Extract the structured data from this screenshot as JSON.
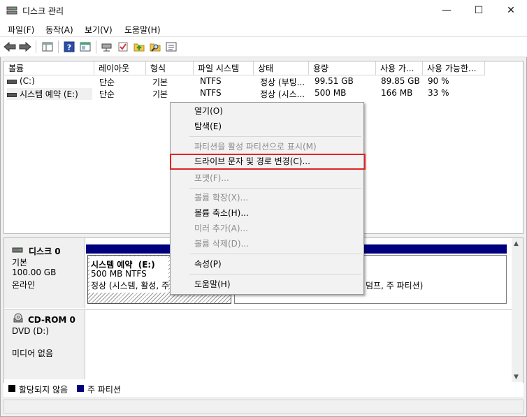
{
  "window": {
    "title": "디스크 관리",
    "minimize": "—",
    "maximize": "☐",
    "close": "✕"
  },
  "menu": [
    "파일(F)",
    "동작(A)",
    "보기(V)",
    "도움말(H)"
  ],
  "toolbar_icons": [
    "back-icon",
    "forward-icon",
    "console-tree-icon",
    "help-icon",
    "properties-icon",
    "connect-icon",
    "check-icon",
    "folder-up-icon",
    "search-icon",
    "settings-icon"
  ],
  "columns": [
    "볼륨",
    "레이아웃",
    "형식",
    "파일 시스템",
    "상태",
    "용량",
    "사용 가...",
    "사용 가능한..."
  ],
  "volumes": [
    {
      "name": "(C:)",
      "layout": "단순",
      "type": "기본",
      "fs": "NTFS",
      "status": "정상 (부팅...",
      "capacity": "99.51 GB",
      "free": "89.85 GB",
      "pct": "90 %"
    },
    {
      "name": "시스템 예약 (E:)",
      "layout": "단순",
      "type": "기본",
      "fs": "NTFS",
      "status": "정상 (시스...",
      "capacity": "500 MB",
      "free": "166 MB",
      "pct": "33 %"
    }
  ],
  "disks": [
    {
      "name": "디스크 0",
      "kind": "기본",
      "size": "100.00 GB",
      "state": "온라인"
    },
    {
      "name": "CD-ROM 0",
      "kind": "DVD (D:)",
      "state": "미디어 없음"
    }
  ],
  "partition": {
    "name": "시스템 예약  (E:)",
    "size": "500 MB NTFS",
    "status": "정상 (시스템, 활성, 주",
    "right_status": "덤프, 주 파티션)"
  },
  "legend": {
    "unallocated": "할당되지 않음",
    "primary": "주 파티션",
    "unallocated_color": "#000000",
    "primary_color": "#00007f"
  },
  "context_menu": [
    {
      "label": "열기(O)",
      "enabled": true
    },
    {
      "label": "탐색(E)",
      "enabled": true
    },
    {
      "label": "파티션을 활성 파티션으로 표시(M)",
      "enabled": false
    },
    {
      "label": "드라이브 문자 및 경로 변경(C)...",
      "enabled": true,
      "highlighted": true
    },
    {
      "label": "포맷(F)...",
      "enabled": false
    },
    {
      "label": "볼륨 확장(X)...",
      "enabled": false
    },
    {
      "label": "볼륨 축소(H)...",
      "enabled": true
    },
    {
      "label": "미러 추가(A)...",
      "enabled": false
    },
    {
      "label": "볼륨 삭제(D)...",
      "enabled": false
    },
    {
      "label": "속성(P)",
      "enabled": true
    },
    {
      "label": "도움말(H)",
      "enabled": true
    }
  ],
  "colors": {
    "highlight_box": "#e02424",
    "disk_bar": "#00007f"
  }
}
